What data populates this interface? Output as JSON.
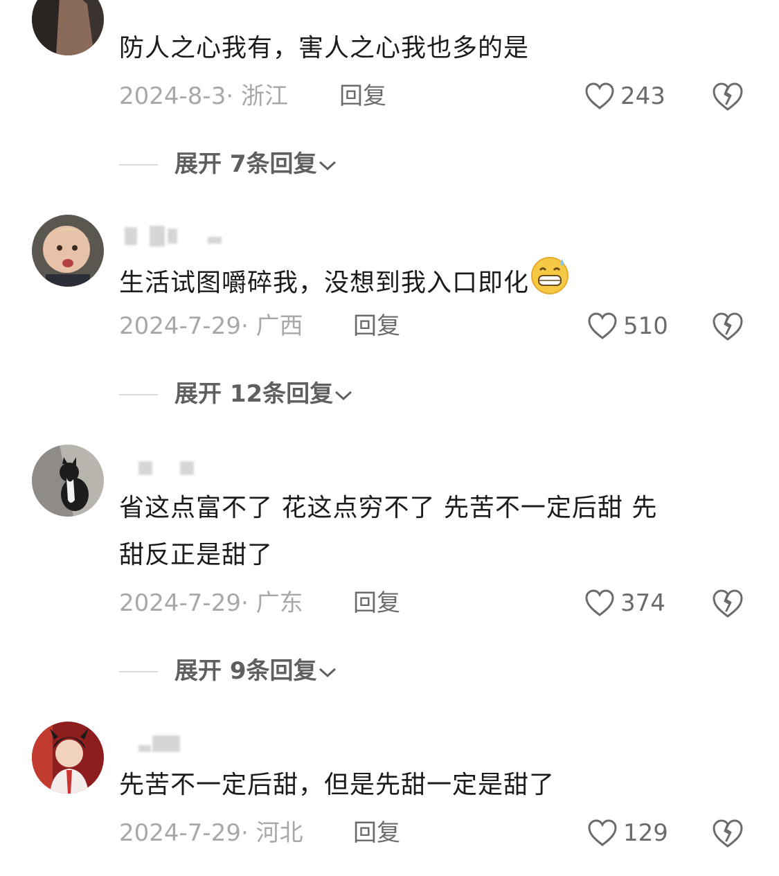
{
  "comments": [
    {
      "text": "防人之心我有，害人之心我也多的是",
      "date_location": "2024-8-3· 浙江",
      "reply_label": "回复",
      "likes": "243",
      "expand_label": "展开 7条回复"
    },
    {
      "text": "生活试图嚼碎我，没想到我入口即化",
      "emoji": "grinning-sweat-emoji",
      "date_location": "2024-7-29· 广西",
      "reply_label": "回复",
      "likes": "510",
      "expand_label": "展开 12条回复"
    },
    {
      "text_line1": "省这点富不了  花这点穷不了 先苦不一定后甜 先",
      "text_line2": "甜反正是甜了",
      "date_location": "2024-7-29· 广东",
      "reply_label": "回复",
      "likes": "374",
      "expand_label": "展开 9条回复"
    },
    {
      "text": "先苦不一定后甜，但是先甜一定是甜了",
      "date_location": "2024-7-29· 河北",
      "reply_label": "回复",
      "likes": "129"
    }
  ],
  "icons": {
    "like": "heart-outline-icon",
    "dislike": "broken-heart-icon",
    "expand": "chevron-down-icon"
  },
  "colors": {
    "text": "#1b1b1b",
    "meta": "#a8a8a8",
    "action": "#6b6b6b"
  }
}
